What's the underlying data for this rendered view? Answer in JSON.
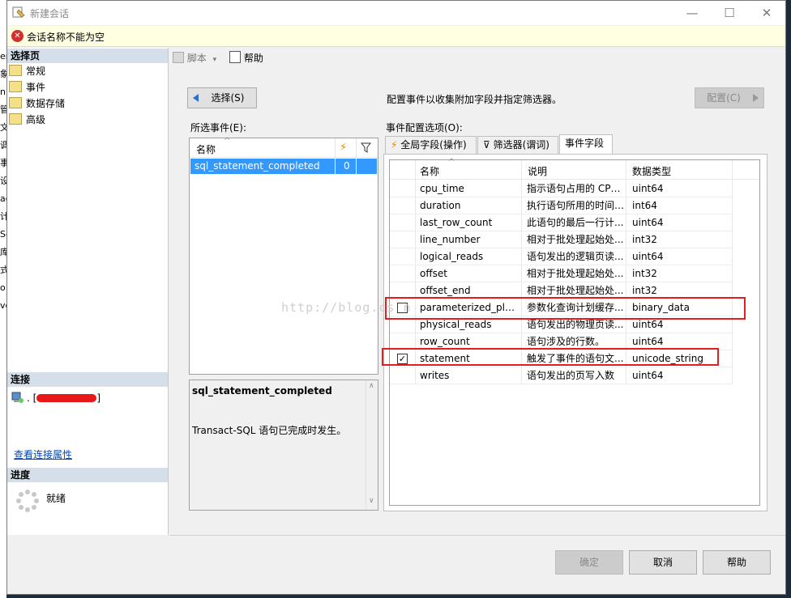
{
  "window": {
    "title": "新建会话",
    "minimize": "—",
    "maximize": "☐",
    "close": "✕"
  },
  "error_bar": {
    "message": "会话名称不能为空"
  },
  "left_pane": {
    "select_page_header": "选择页",
    "pages": [
      "常规",
      "事件",
      "数据存储",
      "高级"
    ],
    "connection_header": "连接",
    "connection_server": ". [",
    "connection_server_end": "]",
    "view_connection_props": "查看连接属性",
    "progress_header": "进度",
    "progress_status": "就绪"
  },
  "bg_left_fragments": [
    "er",
    "象",
    "n",
    "管",
    "文",
    "调",
    "事",
    "设",
    "ag",
    "计",
    "Se",
    "库",
    "式",
    "o",
    "ve"
  ],
  "toolbar": {
    "script_label": "脚本",
    "help_label": "帮助"
  },
  "events": {
    "select_button": "选择(S)",
    "instruction": "配置事件以收集附加字段并指定筛选器。",
    "configure_button": "配置(C)",
    "selected_events_label": "所选事件(E):",
    "config_options_label": "事件配置选项(O):",
    "selected_table": {
      "col_name": "名称",
      "rows": [
        {
          "name": "sql_statement_completed",
          "count": "0"
        }
      ]
    },
    "description_title": "sql_statement_completed",
    "description_text": "Transact-SQL 语句已完成时发生。",
    "tabs": [
      "全局字段(操作)",
      "筛选器(谓词)",
      "事件字段"
    ],
    "fields_table": {
      "col_name": "名称",
      "col_desc": "说明",
      "col_type": "数据类型",
      "rows": [
        {
          "checkbox": false,
          "checked": false,
          "name": "cpu_time",
          "desc": "指示语句占用的 CPU...",
          "type": "uint64"
        },
        {
          "checkbox": false,
          "checked": false,
          "name": "duration",
          "desc": "执行语句所用的时间(...",
          "type": "int64"
        },
        {
          "checkbox": false,
          "checked": false,
          "name": "last_row_count",
          "desc": "此语句的最后一行计...",
          "type": "uint64"
        },
        {
          "checkbox": false,
          "checked": false,
          "name": "line_number",
          "desc": "相对于批处理起始处...",
          "type": "int32"
        },
        {
          "checkbox": false,
          "checked": false,
          "name": "logical_reads",
          "desc": "语句发出的逻辑页读...",
          "type": "uint64"
        },
        {
          "checkbox": false,
          "checked": false,
          "name": "offset",
          "desc": "相对于批处理起始处...",
          "type": "int32"
        },
        {
          "checkbox": false,
          "checked": false,
          "name": "offset_end",
          "desc": "相对于批处理起始处...",
          "type": "int32"
        },
        {
          "checkbox": true,
          "checked": false,
          "name": "parameterized_plan...",
          "desc": "参数化查询计划缓存...",
          "type": "binary_data"
        },
        {
          "checkbox": false,
          "checked": false,
          "name": "physical_reads",
          "desc": "语句发出的物理页读...",
          "type": "uint64"
        },
        {
          "checkbox": false,
          "checked": false,
          "name": "row_count",
          "desc": "语句涉及的行数。",
          "type": "uint64"
        },
        {
          "checkbox": true,
          "checked": true,
          "name": "statement",
          "desc": "触发了事件的语句文...",
          "type": "unicode_string"
        },
        {
          "checkbox": false,
          "checked": false,
          "name": "writes",
          "desc": "语句发出的页写入数",
          "type": "uint64"
        }
      ]
    }
  },
  "watermark": "http://blog.cs    n",
  "footer": {
    "ok": "确定",
    "cancel": "取消",
    "help": "帮助"
  },
  "colors": {
    "highlight": "#3399ff",
    "annotation_red": "#e02020",
    "section_header": "#d5dfea",
    "error_bar": "#ffffe1"
  }
}
